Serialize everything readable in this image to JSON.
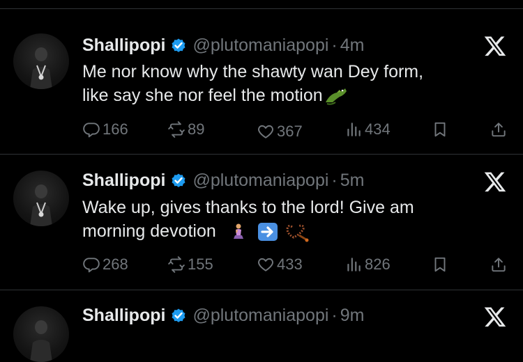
{
  "tweets": [
    {
      "name": "Shallipopi",
      "handle": "@plutomaniapopi",
      "separator": "·",
      "time": "4m",
      "text_line1": "Me nor know why the shawty wan Dey form,",
      "text_line2": "like say she nor feel the motion",
      "emojis": [
        "crocodile-emoji"
      ],
      "replies": "166",
      "reposts": "89",
      "likes": "367",
      "views": "434"
    },
    {
      "name": "Shallipopi",
      "handle": "@plutomaniapopi",
      "separator": "·",
      "time": "5m",
      "text_line1": "Wake up, gives thanks to the lord! Give am",
      "text_line2": "morning devotion",
      "emojis": [
        "kneeling-person-emoji",
        "right-arrow-emoji",
        "prayer-beads-emoji"
      ],
      "replies": "268",
      "reposts": "155",
      "likes": "433",
      "views": "826"
    },
    {
      "name": "Shallipopi",
      "handle": "@plutomaniapopi",
      "separator": "·",
      "time": "9m"
    }
  ],
  "colors": {
    "background": "#000000",
    "text": "#e7e9ea",
    "muted": "#71767b",
    "verified": "#1d9bf0",
    "divider": "#2f3336"
  },
  "icons": [
    "reply-icon",
    "repost-icon",
    "like-icon",
    "views-icon",
    "bookmark-icon",
    "share-icon",
    "x-logo-icon",
    "verified-badge-icon"
  ]
}
